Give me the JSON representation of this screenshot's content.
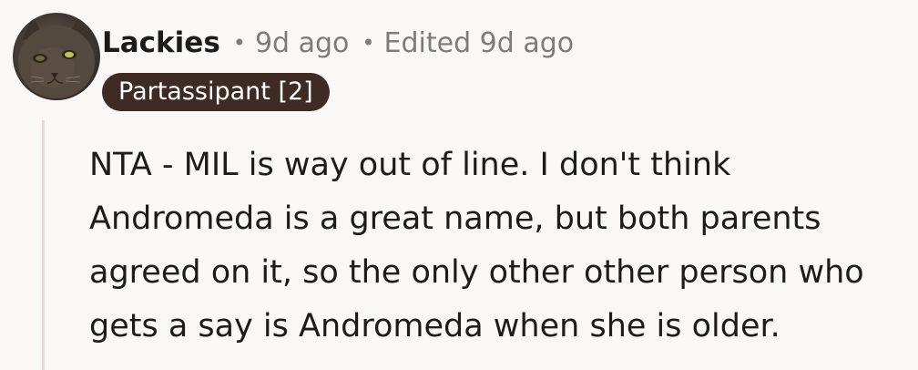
{
  "comment": {
    "username": "Lackies",
    "separator_1": "•",
    "time": "9d ago",
    "separator_2": "•",
    "edited": "Edited 9d ago",
    "flair": "Partassipant [2]",
    "avatar_icon": "cat-avatar-icon",
    "body": "NTA - MIL is way out of line. I don't think Andromeda is a great name, but both parents agreed on it, so the only other other person who gets a say is Andromeda when she is older.",
    "colors": {
      "background": "#faf8f7",
      "flair_bg": "#3d2b24",
      "flair_text": "#ffffff",
      "meta_text": "#7c7c7c",
      "thread_line": "#e8dcd8"
    }
  }
}
